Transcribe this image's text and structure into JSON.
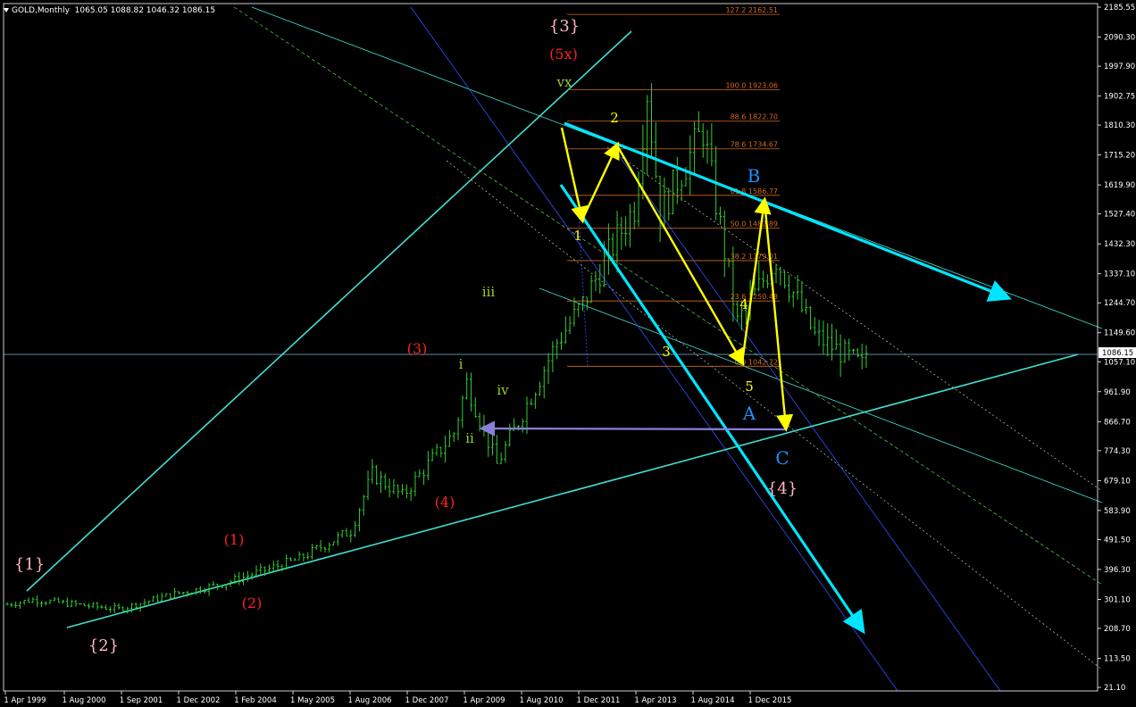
{
  "header": {
    "symbol": "GOLD,Monthly",
    "ohlc": "1065.05 1088.82 1046.32 1086.15"
  },
  "chart_data": {
    "type": "bar",
    "symbol": "GOLD",
    "timeframe": "Monthly",
    "ylim": [
      21.1,
      2185.55
    ],
    "y_ticks": [
      "2185.55",
      "2090.30",
      "1997.90",
      "1902.75",
      "1810.30",
      "1715.20",
      "1619.90",
      "1527.40",
      "1432.30",
      "1337.10",
      "1244.70",
      "1149.60",
      "1057.10",
      "961.90",
      "866.70",
      "774.30",
      "679.10",
      "583.90",
      "491.50",
      "396.30",
      "301.10",
      "208.70",
      "113.50",
      "21.10"
    ],
    "x_ticks": [
      "1 Apr 1999",
      "1 Aug 2000",
      "1 Sep 2001",
      "1 Dec 2002",
      "1 Feb 2004",
      "1 May 2005",
      "1 Aug 2006",
      "1 Dec 2007",
      "1 Apr 2009",
      "1 Aug 2010",
      "1 Dec 2011",
      "1 Apr 2013",
      "1 Aug 2014",
      "1 Dec 2015"
    ],
    "current_price": "1086.15",
    "price_path": [
      [
        "1999-04",
        285
      ],
      [
        "1999-10",
        300
      ],
      [
        "2001-06",
        270
      ],
      [
        "2002-06",
        315
      ],
      [
        "2003-06",
        350
      ],
      [
        "2004-12",
        430
      ],
      [
        "2005-12",
        520
      ],
      [
        "2006-05",
        700
      ],
      [
        "2006-12",
        630
      ],
      [
        "2007-12",
        830
      ],
      [
        "2008-03",
        990
      ],
      [
        "2008-10",
        730
      ],
      [
        "2009-06",
        950
      ],
      [
        "2009-12",
        1120
      ],
      [
        "2010-06",
        1240
      ],
      [
        "2010-12",
        1400
      ],
      [
        "2011-06",
        1550
      ],
      [
        "2011-09",
        1920
      ],
      [
        "2011-12",
        1530
      ],
      [
        "2012-10",
        1795
      ],
      [
        "2013-06",
        1180
      ],
      [
        "2014-03",
        1385
      ],
      [
        "2014-12",
        1140
      ],
      [
        "2015-11",
        1045
      ],
      [
        "2015-12",
        1086
      ]
    ],
    "fibonacci": [
      {
        "label": "127.2",
        "value": "2162.51"
      },
      {
        "label": "100.0",
        "value": "1923.06"
      },
      {
        "label": "88.6",
        "value": "1822.70"
      },
      {
        "label": "78.6",
        "value": "1734.67"
      },
      {
        "label": "61.8",
        "value": "1586.77"
      },
      {
        "label": "50.0",
        "value": "1482.89"
      },
      {
        "label": "38.2",
        "value": "1379.01"
      },
      {
        "label": "23.6",
        "value": "1250.48"
      },
      {
        "label": "0.0",
        "value": "1042.72"
      }
    ],
    "wave_labels": [
      {
        "text": "{1}",
        "color": "#ffb6c1"
      },
      {
        "text": "{2}",
        "color": "#ffb6c1"
      },
      {
        "text": "{3}",
        "color": "#ffb6c1"
      },
      {
        "text": "{4}",
        "color": "#ffb6c1"
      },
      {
        "text": "(5x)",
        "color": "#ff2020"
      },
      {
        "text": "(1)",
        "color": "#ff2020"
      },
      {
        "text": "(2)",
        "color": "#ff2020"
      },
      {
        "text": "(3)",
        "color": "#ff2020"
      },
      {
        "text": "(4)",
        "color": "#ff2020"
      },
      {
        "text": "vx",
        "color": "#9acd32"
      },
      {
        "text": "i",
        "color": "#9acd32"
      },
      {
        "text": "ii",
        "color": "#9acd32"
      },
      {
        "text": "iii",
        "color": "#9acd32"
      },
      {
        "text": "iv",
        "color": "#9acd32"
      },
      {
        "text": "1",
        "color": "#ffff00"
      },
      {
        "text": "2",
        "color": "#ffff00"
      },
      {
        "text": "3",
        "color": "#ffff00"
      },
      {
        "text": "4",
        "color": "#ffff00"
      },
      {
        "text": "5",
        "color": "#ffff00"
      },
      {
        "text": "A",
        "color": "#1e90ff"
      },
      {
        "text": "B",
        "color": "#1e90ff"
      },
      {
        "text": "C",
        "color": "#1e90ff"
      }
    ],
    "colors": {
      "background": "#000000",
      "bars": "#32cd32",
      "axis": "#ffffff",
      "fib": "#d2691e",
      "trend": "#40e0d0",
      "arrow": "#00e5ff",
      "zigzag": "#ffff00",
      "blue_channel": "#3050ff",
      "horizontal_arrow": "#8a7fd8"
    }
  }
}
